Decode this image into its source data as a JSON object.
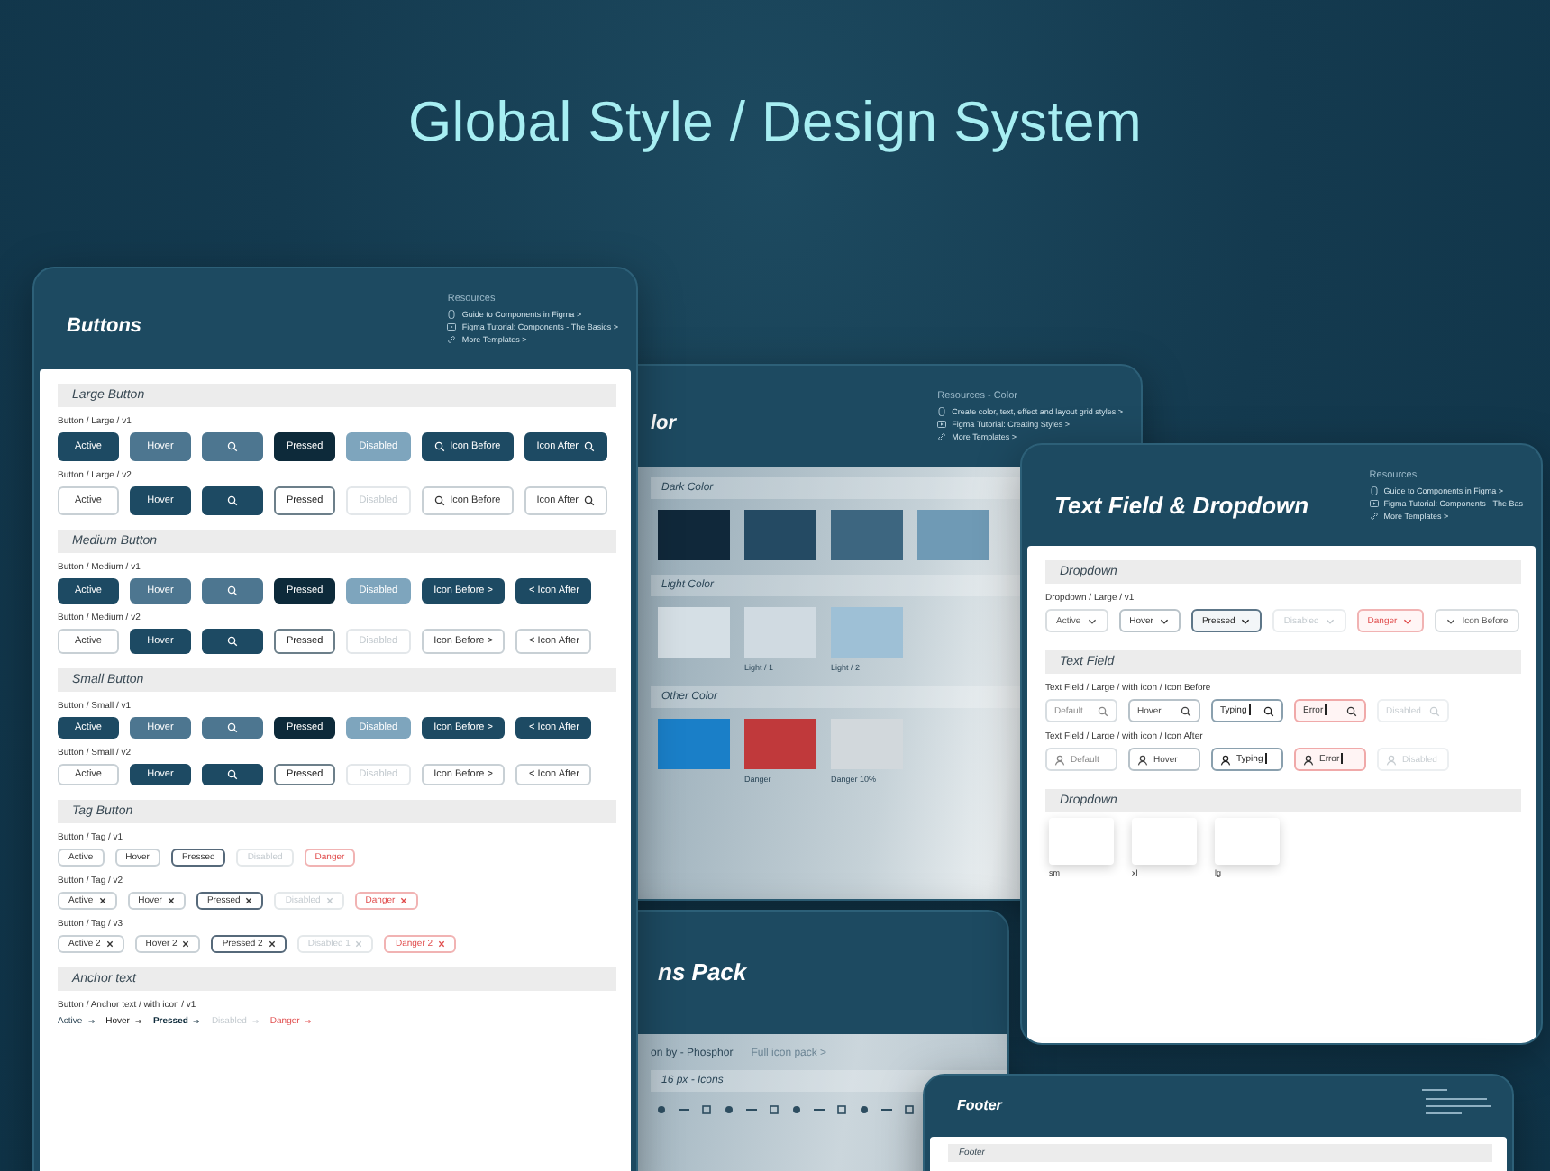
{
  "headline": "Global Style / Design System",
  "buttons_panel": {
    "title": "Buttons",
    "resources": {
      "heading": "Resources",
      "links": [
        "Guide to Components in Figma >",
        "Figma Tutorial: Components - The Basics >",
        "More Templates >"
      ]
    },
    "sections": [
      {
        "heading": "Large Button",
        "kind": "large",
        "rows": [
          {
            "label": "Button / Large / v1",
            "kind": "solid",
            "items": [
              {
                "kind": "active",
                "label": "Active",
                "icon_before": false,
                "icon_after": false
              },
              {
                "kind": "hover",
                "label": "Hover",
                "icon_before": false,
                "icon_after": false
              },
              {
                "kind": "hover",
                "icon_before": true,
                "icon_after": false
              },
              {
                "kind": "pressed",
                "label": "Pressed",
                "icon_before": false,
                "icon_after": false
              },
              {
                "kind": "disabled",
                "label": "Disabled",
                "icon_before": false,
                "icon_after": false
              },
              {
                "kind": "active",
                "label": "Icon Before",
                "icon_before": true,
                "icon_after": false
              },
              {
                "kind": "active",
                "label": "Icon After",
                "icon_before": false,
                "icon_after": true
              }
            ]
          },
          {
            "label": "Button / Large / v2",
            "kind": "outline",
            "items": [
              {
                "kind": "active",
                "label": "Active",
                "icon_before": false,
                "icon_after": false
              },
              {
                "kind": "hover",
                "label": "Hover",
                "icon_before": false,
                "icon_after": false
              },
              {
                "kind": "hover",
                "icon_before": true,
                "icon_after": false
              },
              {
                "kind": "pressed",
                "label": "Pressed",
                "icon_before": false,
                "icon_after": false
              },
              {
                "kind": "disabled",
                "label": "Disabled",
                "icon_before": false,
                "icon_after": false
              },
              {
                "kind": "active",
                "label": "Icon Before",
                "icon_before": true,
                "icon_after": false
              },
              {
                "kind": "active",
                "label": "Icon After",
                "icon_before": false,
                "icon_after": true
              }
            ]
          }
        ]
      },
      {
        "heading": "Medium Button",
        "kind": "medium",
        "rows": [
          {
            "label": "Button / Medium / v1",
            "kind": "solid",
            "items": [
              {
                "kind": "active",
                "label": "Active",
                "icon_before": false,
                "icon_after": false
              },
              {
                "kind": "hover",
                "label": "Hover",
                "icon_before": false,
                "icon_after": false
              },
              {
                "kind": "hover",
                "icon_before": true,
                "icon_after": false
              },
              {
                "kind": "pressed",
                "label": "Pressed",
                "icon_before": false,
                "icon_after": false
              },
              {
                "kind": "disabled",
                "label": "Disabled",
                "icon_before": false,
                "icon_after": false
              },
              {
                "kind": "active",
                "label": "Icon Before >",
                "icon_before": false,
                "icon_after": false
              },
              {
                "kind": "active",
                "label": "< Icon After",
                "icon_before": false,
                "icon_after": false
              }
            ]
          },
          {
            "label": "Button / Medium / v2",
            "kind": "outline",
            "items": [
              {
                "kind": "active",
                "label": "Active",
                "icon_before": false,
                "icon_after": false
              },
              {
                "kind": "hover",
                "label": "Hover",
                "icon_before": false,
                "icon_after": false
              },
              {
                "kind": "hover",
                "icon_before": true,
                "icon_after": false
              },
              {
                "kind": "pressed",
                "label": "Pressed",
                "icon_before": false,
                "icon_after": false
              },
              {
                "kind": "disabled",
                "label": "Disabled",
                "icon_before": false,
                "icon_after": false
              },
              {
                "kind": "active",
                "label": "Icon Before >",
                "icon_before": false,
                "icon_after": false
              },
              {
                "kind": "active",
                "label": "< Icon After",
                "icon_before": false,
                "icon_after": false
              }
            ]
          }
        ]
      },
      {
        "heading": "Small Button",
        "kind": "small",
        "rows": [
          {
            "label": "Button / Small / v1",
            "kind": "solid",
            "items": [
              {
                "kind": "active",
                "label": "Active",
                "icon_before": false,
                "icon_after": false
              },
              {
                "kind": "hover",
                "label": "Hover",
                "icon_before": false,
                "icon_after": false
              },
              {
                "kind": "hover",
                "icon_before": true,
                "icon_after": false
              },
              {
                "kind": "pressed",
                "label": "Pressed",
                "icon_before": false,
                "icon_after": false
              },
              {
                "kind": "disabled",
                "label": "Disabled",
                "icon_before": false,
                "icon_after": false
              },
              {
                "kind": "active",
                "label": "Icon Before >",
                "icon_before": false,
                "icon_after": false
              },
              {
                "kind": "active",
                "label": "< Icon After",
                "icon_before": false,
                "icon_after": false
              }
            ]
          },
          {
            "label": "Button / Small / v2",
            "kind": "outline",
            "items": [
              {
                "kind": "active",
                "label": "Active",
                "icon_before": false,
                "icon_after": false
              },
              {
                "kind": "hover",
                "label": "Hover",
                "icon_before": false,
                "icon_after": false
              },
              {
                "kind": "hover",
                "icon_before": true,
                "icon_after": false
              },
              {
                "kind": "pressed",
                "label": "Pressed",
                "icon_before": false,
                "icon_after": false
              },
              {
                "kind": "disabled",
                "label": "Disabled",
                "icon_before": false,
                "icon_after": false
              },
              {
                "kind": "active",
                "label": "Icon Before >",
                "icon_before": false,
                "icon_after": false
              },
              {
                "kind": "active",
                "label": "< Icon After",
                "icon_before": false,
                "icon_after": false
              }
            ]
          }
        ]
      },
      {
        "heading": "Tag Button",
        "kind": "tag",
        "rows": [
          {
            "label": "Button / Tag / v1",
            "items": [
              {
                "label": "Active",
                "kind": "active",
                "closable": false
              },
              {
                "label": "Hover",
                "kind": "hover",
                "closable": false
              },
              {
                "label": "Pressed",
                "kind": "pressed",
                "closable": false
              },
              {
                "label": "Disabled",
                "kind": "disabled",
                "closable": false
              },
              {
                "label": "Danger",
                "kind": "danger",
                "closable": false
              }
            ]
          },
          {
            "label": "Button / Tag / v2",
            "items": [
              {
                "label": "Active",
                "kind": "active",
                "closable": true
              },
              {
                "label": "Hover",
                "kind": "hover",
                "closable": true
              },
              {
                "label": "Pressed",
                "kind": "pressed",
                "closable": true
              },
              {
                "label": "Disabled",
                "kind": "disabled",
                "closable": true
              },
              {
                "label": "Danger",
                "kind": "danger",
                "closable": true
              }
            ]
          },
          {
            "label": "Button / Tag / v3",
            "items": [
              {
                "label": "Active 2",
                "kind": "active",
                "closable": true
              },
              {
                "label": "Hover 2",
                "kind": "hover",
                "closable": true
              },
              {
                "label": "Pressed 2",
                "kind": "pressed",
                "closable": true
              },
              {
                "label": "Disabled 1",
                "kind": "disabled",
                "closable": true
              },
              {
                "label": "Danger 2",
                "kind": "danger",
                "closable": true
              }
            ]
          }
        ]
      },
      {
        "heading": "Anchor text",
        "kind": "anchor",
        "rows": [
          {
            "label": "Button / Anchor text / with icon / v1",
            "items": [
              {
                "label": "Active",
                "kind": "active"
              },
              {
                "label": "Hover",
                "kind": "hover"
              },
              {
                "label": "Pressed",
                "kind": "pressed"
              },
              {
                "label": "Disabled",
                "kind": "disabled"
              },
              {
                "label": "Danger",
                "kind": "danger"
              }
            ]
          }
        ]
      }
    ]
  },
  "color_panel": {
    "title": "lor",
    "resources": {
      "heading": "Resources - Color",
      "links": [
        "Create color, text, effect and layout grid styles >",
        "Figma Tutorial: Creating Styles >",
        "More Templates >"
      ]
    },
    "sections": [
      {
        "heading": "Dark Color",
        "swatches": [
          {
            "color": "#10283a"
          },
          {
            "color": "#244a63"
          },
          {
            "color": "#3d6680"
          },
          {
            "color": "#6f9ab5"
          }
        ]
      },
      {
        "heading": "Light Color",
        "swatches": [
          {
            "color": "#d5dfe5"
          },
          {
            "color": "#d0dae1",
            "label": "Light / 1"
          },
          {
            "color": "#9ec0d6",
            "label": "Light / 2"
          }
        ]
      },
      {
        "heading": "Other Color",
        "swatches": [
          {
            "color": "#1a7fc8"
          },
          {
            "color": "#c0393b",
            "label": "Danger"
          },
          {
            "color": "#d2d8dc",
            "label": "Danger 10%"
          }
        ]
      }
    ]
  },
  "icons_panel": {
    "title": "ns Pack",
    "source": "on by - Phosphor",
    "link": "Full icon pack >",
    "section": "16 px - Icons"
  },
  "field_panel": {
    "title": "Text Field & Dropdown",
    "resources": {
      "heading": "Resources",
      "links": [
        "Guide to Components in Figma >",
        "Figma Tutorial: Components - The Bas",
        "More Templates >"
      ]
    },
    "dropdown": {
      "heading": "Dropdown",
      "label": "Dropdown / Large / v1",
      "items": [
        {
          "label": "Active",
          "kind": "active",
          "chevron_before": false
        },
        {
          "label": "Hover",
          "kind": "hover",
          "chevron_before": false
        },
        {
          "label": "Pressed",
          "kind": "pressed",
          "chevron_before": false
        },
        {
          "label": "Disabled",
          "kind": "disabled",
          "chevron_before": false
        },
        {
          "label": "Danger",
          "kind": "danger",
          "chevron_before": false
        },
        {
          "label": "Icon Before",
          "kind": "active",
          "chevron_before": true
        }
      ]
    },
    "text_field": {
      "heading": "Text Field",
      "rows": [
        {
          "label": "Text Field / Large / with icon / Icon Before",
          "kind": "trailing",
          "items": [
            {
              "text": "Default",
              "kind": "default"
            },
            {
              "text": "Hover",
              "kind": "hover"
            },
            {
              "text": "Typing",
              "kind": "typing"
            },
            {
              "text": "Error",
              "kind": "error"
            },
            {
              "text": "Disabled",
              "kind": "disabled"
            }
          ]
        },
        {
          "label": "Text Field / Large / with icon / Icon After",
          "kind": "leading",
          "items": [
            {
              "text": "Default",
              "kind": "default"
            },
            {
              "text": "Hover",
              "kind": "hover"
            },
            {
              "text": "Typing",
              "kind": "typing"
            },
            {
              "text": "Error",
              "kind": "error"
            },
            {
              "text": "Disabled",
              "kind": "disabled"
            }
          ]
        }
      ]
    },
    "menus": {
      "heading": "Dropdown",
      "sizes": [
        "sm",
        "xl",
        "lg"
      ]
    }
  },
  "footer_panel": {
    "title": "Footer",
    "section": "Footer"
  }
}
